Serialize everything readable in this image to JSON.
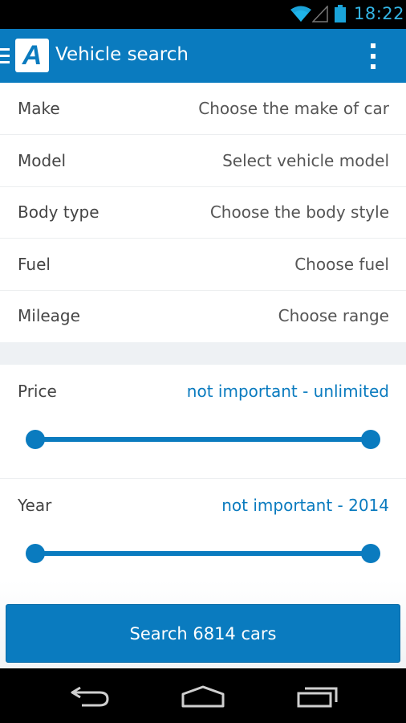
{
  "status_bar": {
    "time": "18:22",
    "wifi_icon": "wifi-icon",
    "signal_icon": "signal-icon",
    "battery_icon": "battery-icon"
  },
  "app_bar": {
    "menu_icon": "menu-icon",
    "logo_letter": "A",
    "title": "Vehicle search",
    "overflow_icon": "overflow-menu-icon"
  },
  "filters": [
    {
      "label": "Make",
      "value": "Choose the make of car"
    },
    {
      "label": "Model",
      "value": "Select vehicle model"
    },
    {
      "label": "Body type",
      "value": "Choose the body style"
    },
    {
      "label": "Fuel",
      "value": "Choose fuel"
    },
    {
      "label": "Mileage",
      "value": "Choose range"
    }
  ],
  "price": {
    "label": "Price",
    "value": "not important - unlimited",
    "range": [
      0,
      1
    ]
  },
  "year": {
    "label": "Year",
    "value": "not important - 2014",
    "range": [
      0,
      1
    ]
  },
  "search_button": {
    "label": "Search 6814 cars"
  },
  "nav_bar": {
    "back_icon": "back-icon",
    "home_icon": "home-icon",
    "recents_icon": "recents-icon"
  },
  "colors": {
    "primary": "#0a7bbf",
    "status_accent": "#33b5e5"
  }
}
